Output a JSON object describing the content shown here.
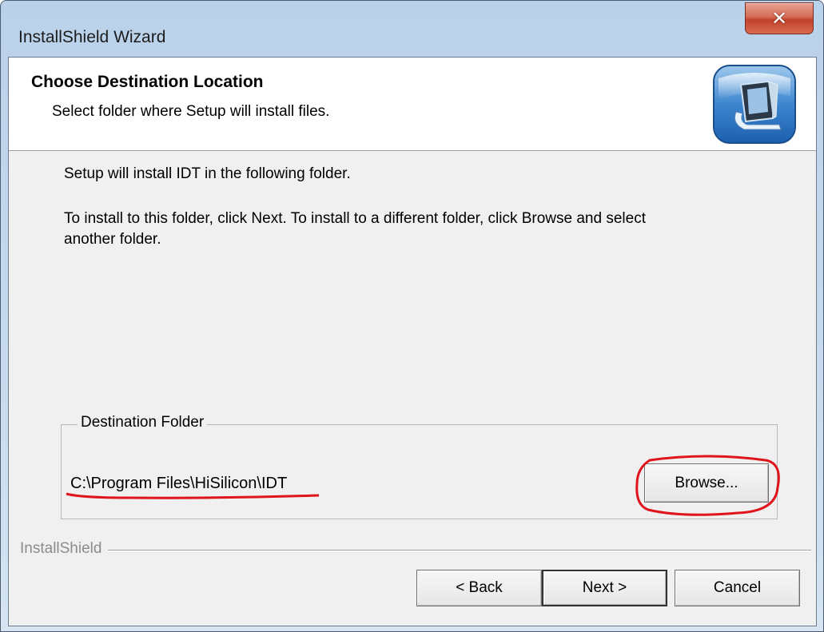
{
  "window": {
    "title": "InstallShield Wizard"
  },
  "header": {
    "title": "Choose Destination Location",
    "subtitle": "Select folder where Setup will install files.",
    "icon": "computer-setup-icon"
  },
  "body": {
    "line1": "Setup will install IDT in the following folder.",
    "line2": "To install to this folder, click Next. To install to a different folder, click Browse and select",
    "line3": "another folder."
  },
  "destination": {
    "legend": "Destination Folder",
    "path": "C:\\Program Files\\HiSilicon\\IDT",
    "browse_label": "Browse..."
  },
  "footer": {
    "brand": "InstallShield",
    "back_label": "< Back",
    "next_label": "Next >",
    "cancel_label": "Cancel"
  },
  "colors": {
    "annotation": "#e0141b"
  }
}
